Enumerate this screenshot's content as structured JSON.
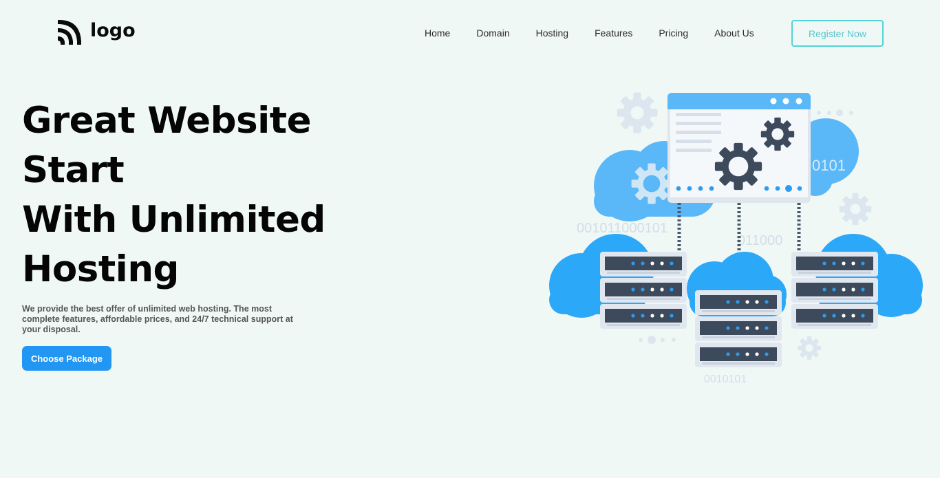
{
  "header": {
    "logo_text": "logo",
    "nav": [
      {
        "label": "Home"
      },
      {
        "label": "Domain"
      },
      {
        "label": "Hosting"
      },
      {
        "label": "Features"
      },
      {
        "label": "Pricing"
      },
      {
        "label": "About Us"
      }
    ],
    "register_label": "Register Now"
  },
  "hero": {
    "title_lines": [
      "Great Website",
      "Start",
      "With Unlimited",
      "Hosting"
    ],
    "description": "We provide the best offer of unlimited web hosting. The most complete features, affordable prices, and 24/7 technical support at your disposal.",
    "cta_label": "Choose Package"
  },
  "illustration": {
    "binary_labels": [
      "0101",
      "001011000101",
      "011000",
      "0010101"
    ]
  },
  "colors": {
    "background": "#f0f8f6",
    "accent_blue": "#2196f3",
    "register_border": "#52d4d8",
    "server_dark": "#3d4a5c",
    "cloud_blue": "#5ab8f8"
  }
}
